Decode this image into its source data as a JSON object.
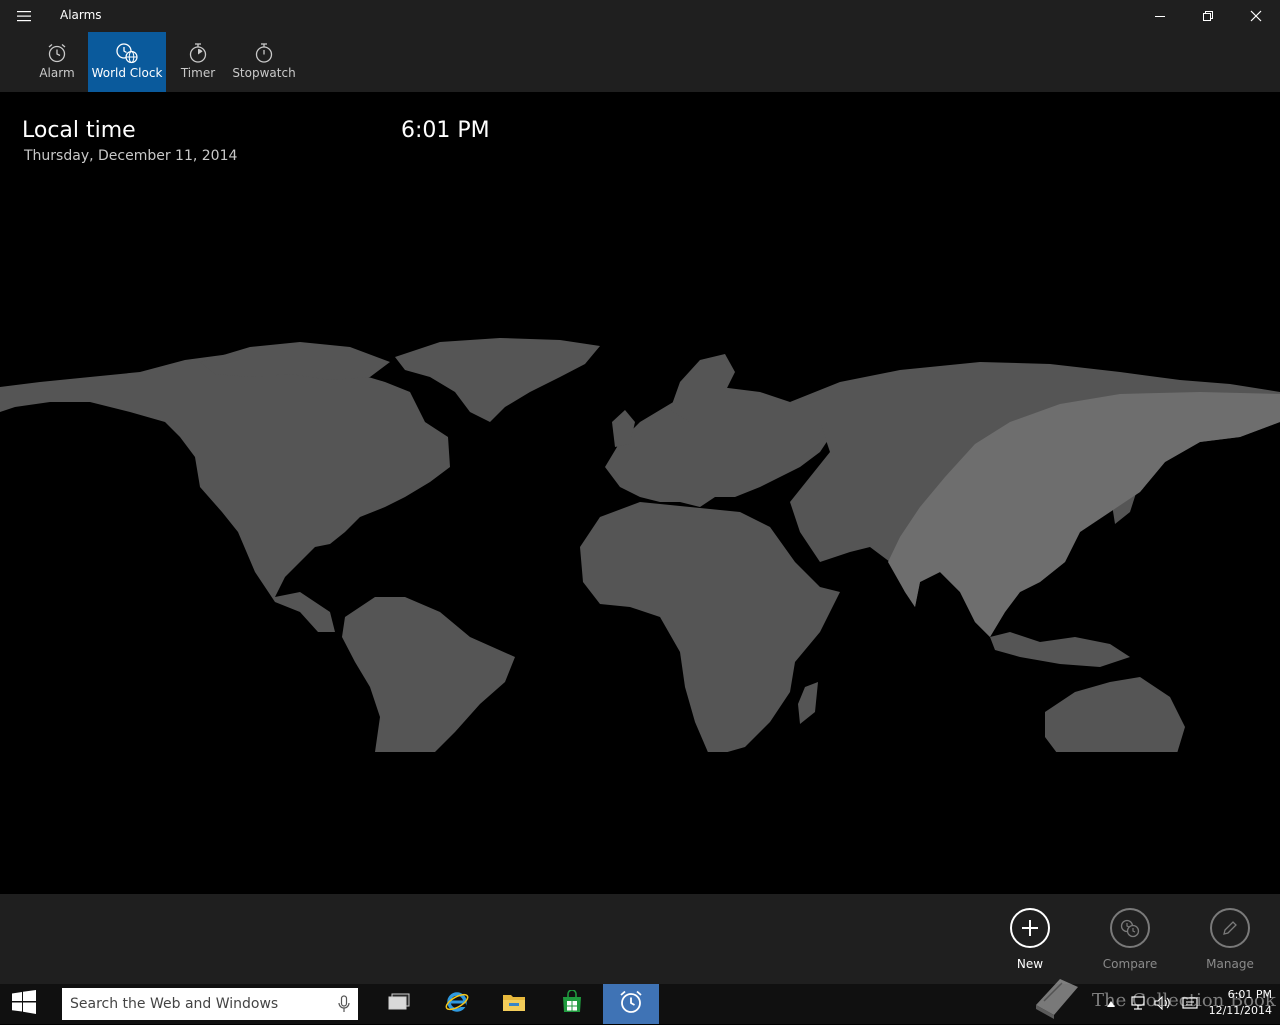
{
  "window": {
    "title": "Alarms",
    "menu_icon": "hamburger-icon",
    "controls": [
      "minimize-icon",
      "restore-icon",
      "close-icon"
    ]
  },
  "tabs": [
    {
      "label": "Alarm",
      "icon": "alarm-clock-icon",
      "active": false
    },
    {
      "label": "World Clock",
      "icon": "world-clock-icon",
      "active": true
    },
    {
      "label": "Timer",
      "icon": "timer-icon",
      "active": false
    },
    {
      "label": "Stopwatch",
      "icon": "stopwatch-icon",
      "active": false
    }
  ],
  "local": {
    "label": "Local time",
    "time": "6:01 PM",
    "date": "Thursday, December 11, 2014"
  },
  "map": {
    "land_color": "#555555",
    "daylight_color": "#6e6e6e",
    "ocean_color": "#000000"
  },
  "commands": [
    {
      "label": "New",
      "icon": "plus-icon",
      "enabled": true
    },
    {
      "label": "Compare",
      "icon": "compare-icon",
      "enabled": false
    },
    {
      "label": "Manage",
      "icon": "pencil-icon",
      "enabled": false
    }
  ],
  "taskbar": {
    "search_placeholder": "Search the Web and Windows",
    "apps": [
      "task-view-icon",
      "internet-explorer-icon",
      "file-explorer-icon",
      "store-icon",
      "alarms-app-icon"
    ],
    "tray_icons": [
      "chevron-up-icon",
      "network-icon",
      "volume-icon",
      "action-center-icon"
    ],
    "clock_time": "6:01 PM",
    "clock_date": "12/11/2014"
  },
  "watermark": "The Collection Book",
  "colors": {
    "accent": "#0a5a9c",
    "chrome": "#1f1f1f",
    "taskbar": "#101010",
    "taskbar_active": "#3f73b5"
  }
}
